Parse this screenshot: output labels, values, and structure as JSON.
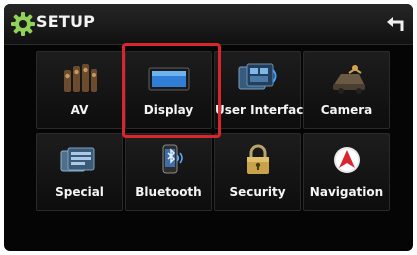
{
  "header": {
    "title": "SETUP",
    "back_icon": "back-arrow-icon"
  },
  "menu": [
    {
      "label": "AV",
      "icon": "speakers-icon"
    },
    {
      "label": "Display",
      "icon": "display-monitor-icon"
    },
    {
      "label": "User Interface",
      "icon": "user-interface-icon"
    },
    {
      "label": "Camera",
      "icon": "camera-icon"
    },
    {
      "label": "Special",
      "icon": "special-screens-icon"
    },
    {
      "label": "Bluetooth",
      "icon": "bluetooth-phone-icon"
    },
    {
      "label": "Security",
      "icon": "padlock-icon"
    },
    {
      "label": "Navigation",
      "icon": "navigation-icon"
    }
  ],
  "colors": {
    "highlight": "#d8262c",
    "background": "#050505"
  }
}
